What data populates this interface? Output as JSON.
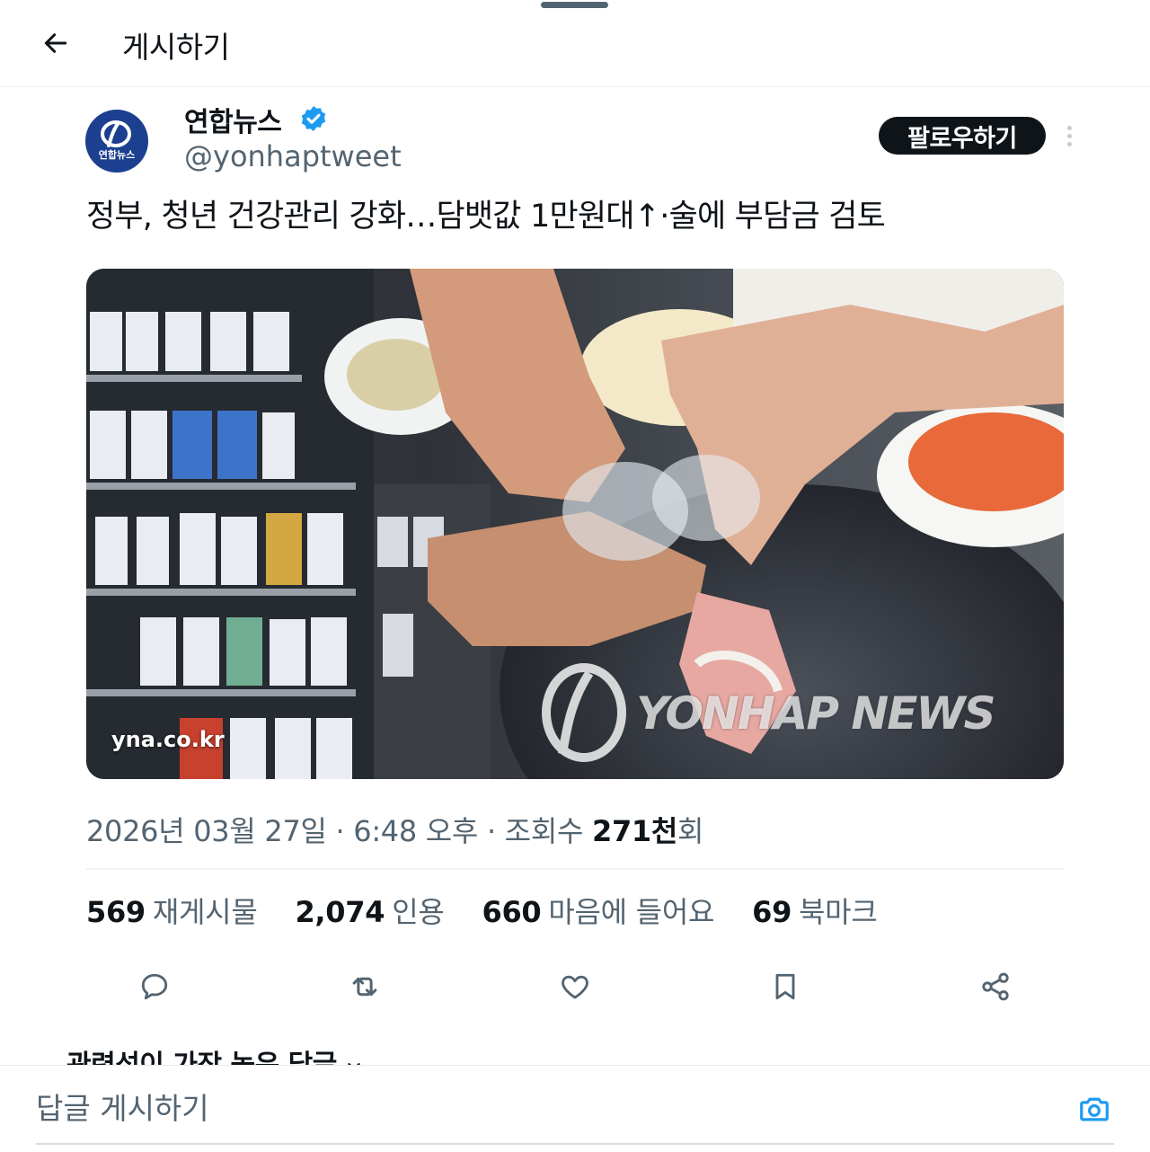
{
  "header": {
    "title": "게시하기",
    "back_icon": "arrow-left-icon"
  },
  "author": {
    "name": "연합뉴스",
    "handle": "@yonhaptweet",
    "avatar_text": "연합뉴스",
    "verified": true,
    "follow_label": "팔로우하기",
    "brand_color": "#1c3f8f",
    "verified_color": "#1d9bf0"
  },
  "tweet": {
    "text": "정부, 청년 건강관리 강화…담뱃값 1만원대↑·술에 부담금 검토",
    "media": {
      "caption": "yna.co.kr",
      "watermark": "YONHAP NEWS",
      "description_icon": "photo"
    },
    "meta": {
      "datetime": "2026년 03월 27일 · 6:48 오후 · 조회수",
      "views": "271천",
      "views_suffix": "회"
    }
  },
  "stats": [
    {
      "value": "569",
      "label": "재게시물"
    },
    {
      "value": "2,074",
      "label": "인용"
    },
    {
      "value": "660",
      "label": "마음에 들어요"
    },
    {
      "value": "69",
      "label": "북마크"
    }
  ],
  "actions": [
    "reply-icon",
    "repost-icon",
    "like-icon",
    "bookmark-icon",
    "share-icon"
  ],
  "replies": {
    "sort_label": "관련성이 가장 높은 답글"
  },
  "composer": {
    "placeholder": "답글 게시하기",
    "accent": "#1d9bf0"
  }
}
